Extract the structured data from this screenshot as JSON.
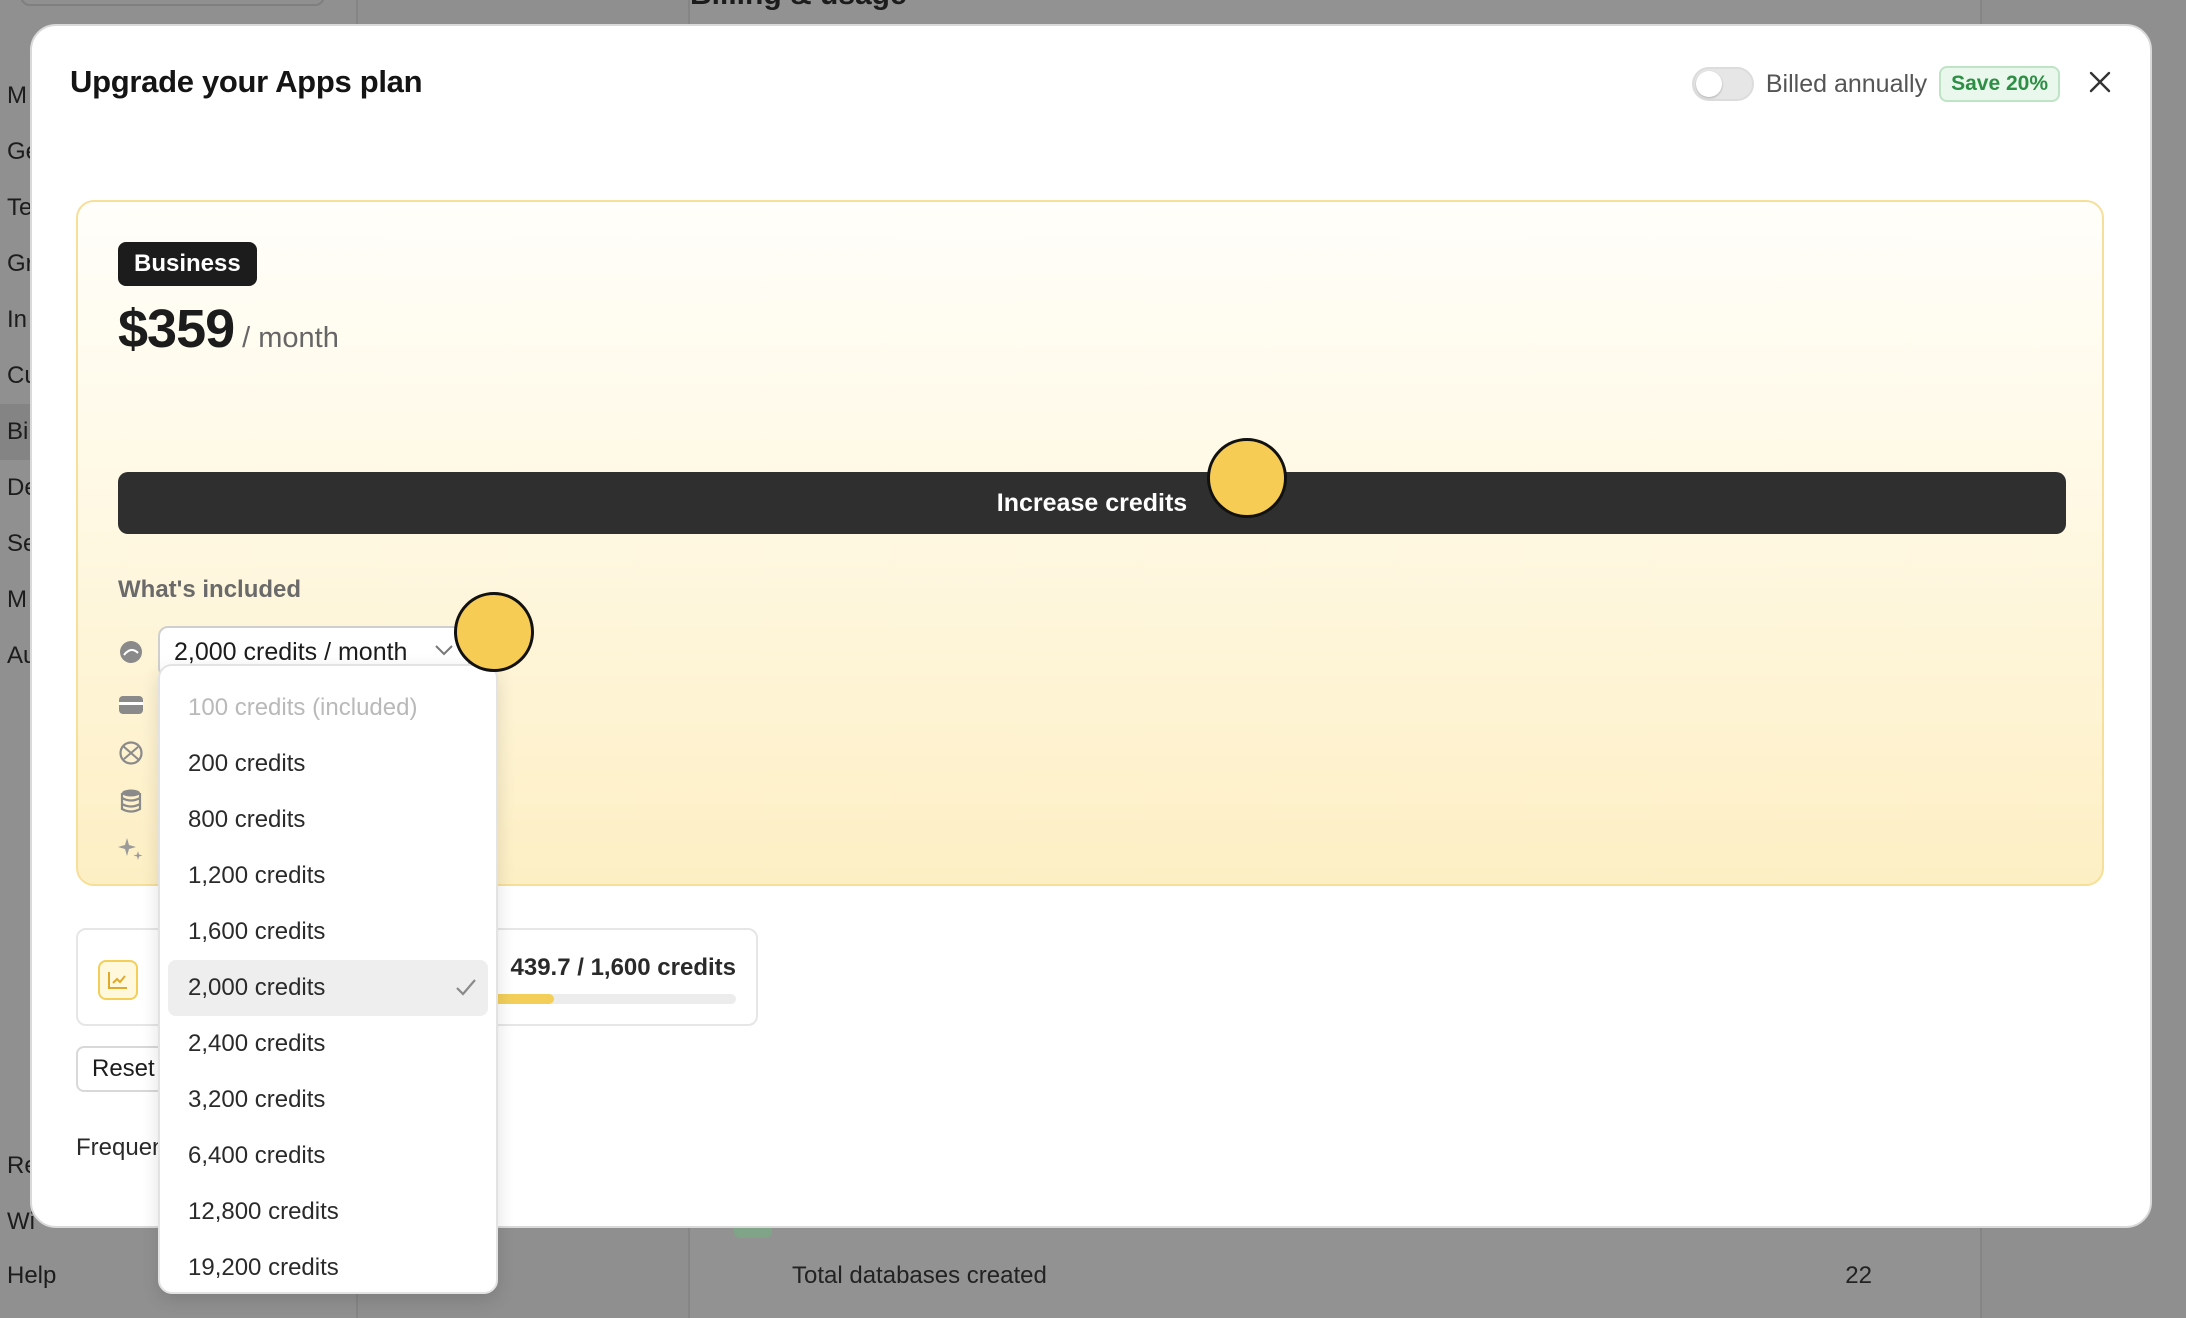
{
  "background": {
    "page_title": "Billing & usage",
    "sidebar_items": [
      "M",
      "Ge",
      "Te",
      "Gr",
      "In",
      "Cu",
      "Bi",
      "De",
      "Se",
      "M",
      "Au",
      "Re",
      "Wi",
      "Help"
    ],
    "stats_row": {
      "label": "Total databases created",
      "value": "22"
    }
  },
  "modal": {
    "title": "Upgrade your Apps plan",
    "billing_toggle_label": "Billed annually",
    "billing_toggle_on": false,
    "save_badge": "Save 20%",
    "close_icon": "close-icon"
  },
  "plan": {
    "name": "Business",
    "price": "$359",
    "period": "/ month",
    "cta_label": "Increase credits",
    "included_label": "What's included",
    "credits_selected": "2,000 credits / month",
    "feature_icons": [
      "credits-icon",
      "card-icon",
      "globe-icon",
      "database-icon",
      "sparkles-icon"
    ]
  },
  "usage": {
    "text": "439.7 / 1,600 credits",
    "progress_fraction": 0.27
  },
  "reset_label": "Reset",
  "faq_label": "Frequen",
  "dropdown": {
    "options": [
      {
        "label": "100 credits  (included)",
        "disabled": true,
        "selected": false
      },
      {
        "label": "200 credits",
        "disabled": false,
        "selected": false
      },
      {
        "label": "800 credits",
        "disabled": false,
        "selected": false
      },
      {
        "label": "1,200 credits",
        "disabled": false,
        "selected": false
      },
      {
        "label": "1,600 credits",
        "disabled": false,
        "selected": false
      },
      {
        "label": "2,000 credits",
        "disabled": false,
        "selected": true
      },
      {
        "label": "2,400 credits",
        "disabled": false,
        "selected": false
      },
      {
        "label": "3,200 credits",
        "disabled": false,
        "selected": false
      },
      {
        "label": "6,400 credits",
        "disabled": false,
        "selected": false
      },
      {
        "label": "12,800 credits",
        "disabled": false,
        "selected": false
      },
      {
        "label": "19,200 credits",
        "disabled": false,
        "selected": false
      }
    ]
  },
  "colors": {
    "accent": "#f6cc55",
    "save_green": "#2d8f45",
    "cta": "#2f2f2f"
  }
}
